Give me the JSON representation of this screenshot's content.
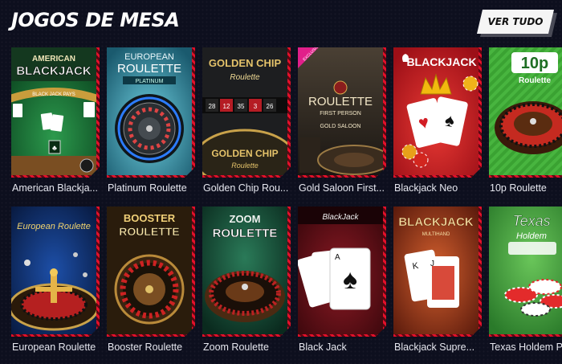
{
  "section": {
    "title": "JOGOS DE MESA",
    "view_all_label": "VER TUDO"
  },
  "games": [
    {
      "label": "American Blackja...",
      "art_title": [
        "AMERICAN",
        "BLACKJACK"
      ],
      "art_sub": "BLACK JACK PAYS",
      "accent": "#1f7a3a"
    },
    {
      "label": "Platinum Roulette",
      "art_title": [
        "EUROPEAN",
        "ROULETTE"
      ],
      "art_sub": "PLATINUM",
      "accent": "#2d8aa0"
    },
    {
      "label": "Golden Chip Rou...",
      "art_title": [
        "GOLDEN CHIP",
        "Roulette"
      ],
      "art_sub": "GOLDEN CHIP",
      "accent": "#c9a64a"
    },
    {
      "label": "Gold Saloon First...",
      "art_title": [
        "ROULETTE",
        "FIRST PERSON"
      ],
      "art_sub": "GOLD SALOON",
      "badge": "EXCLUSIVO",
      "accent": "#c8a24e"
    },
    {
      "label": "Blackjack Neo",
      "art_title": [
        "BLACKJACK"
      ],
      "art_sub": "",
      "accent": "#e0212e"
    },
    {
      "label": "10p Roulette",
      "art_title": [
        "10p",
        "Roulette"
      ],
      "art_sub": "",
      "accent": "#3ea33a"
    },
    {
      "label": "European Roulette",
      "art_title": [
        "European Roulette"
      ],
      "art_sub": "",
      "accent": "#1a3f8c"
    },
    {
      "label": "Booster Roulette",
      "art_title": [
        "BOOSTER",
        "ROULETTE"
      ],
      "art_sub": "",
      "accent": "#d4a54a"
    },
    {
      "label": "Zoom Roulette",
      "art_title": [
        "ZOOM",
        "ROULETTE"
      ],
      "art_sub": "",
      "accent": "#1e5a44"
    },
    {
      "label": "Black Jack",
      "art_title": [
        "BlackJack"
      ],
      "art_sub": "",
      "accent": "#8c1620"
    },
    {
      "label": "Blackjack Supre...",
      "art_title": [
        "BLACKJACK"
      ],
      "art_sub": "MULTIHAND",
      "accent": "#c24a2e"
    },
    {
      "label": "Texas Holdem Po...",
      "art_title": [
        "Texas",
        "Holdem"
      ],
      "art_sub": "",
      "accent": "#4ea83e"
    }
  ]
}
